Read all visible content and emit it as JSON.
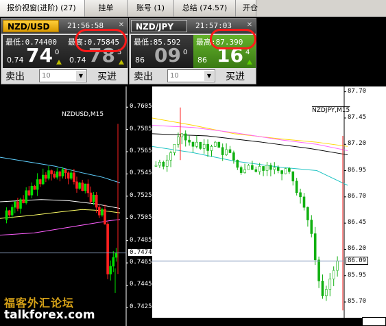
{
  "tabs": [
    {
      "label": "报价视窗(进阶) (27)",
      "active": true
    },
    {
      "label": "挂单",
      "active": false
    },
    {
      "label": "账号 (1)",
      "active": false
    },
    {
      "label": "总结 (74.57)",
      "active": false
    },
    {
      "label": "开仓",
      "active": false
    }
  ],
  "quotes": [
    {
      "symbol": "NZD/USD",
      "symbol_style": "gold",
      "time": "21:56:58",
      "sell": {
        "low_label": "最低:0.74400",
        "small": "0.74",
        "big": "74",
        "sup": "0",
        "label": "卖出"
      },
      "buy": {
        "high_label": "最高:0.75845",
        "small": "0.74",
        "big": "78",
        "sup": "5",
        "label": "买进"
      },
      "amount": "10"
    },
    {
      "symbol": "NZD/JPY",
      "symbol_style": "dark",
      "time": "21:57:03",
      "sell": {
        "low_label": "最低:85.592",
        "small": "86",
        "big": "09",
        "sup": "0",
        "label": "卖出"
      },
      "buy": {
        "high_label": "最高:87.390",
        "small": "86",
        "big": "16",
        "sup": "4",
        "label": "买进"
      },
      "amount": "10"
    }
  ],
  "chart_data": [
    {
      "type": "candlestick",
      "title": "NZDUSD,M15",
      "yticks": [
        "0.7605",
        "0.7585",
        "0.7565",
        "0.7545",
        "0.7525",
        "0.7505",
        "0.7485",
        "0.7465",
        "0.7445",
        "0.7425"
      ],
      "ylim": [
        0.742,
        0.7615
      ],
      "current_price": "0.7474",
      "ma_colors": [
        "#5fd0ff",
        "#ffff66",
        "#ff5fff",
        "#ffffff"
      ]
    },
    {
      "type": "candlestick",
      "title": "NZDJPY,M15",
      "yticks": [
        "87.70",
        "87.45",
        "87.20",
        "86.95",
        "86.70",
        "86.45",
        "86.20",
        "85.95",
        "85.70"
      ],
      "ylim": [
        85.55,
        87.75
      ],
      "current_price": "86.09",
      "ma_colors": [
        "#ffd700",
        "#ff66ff",
        "#22c4c4",
        "#000000"
      ]
    }
  ],
  "watermark": {
    "cn": "福客外汇论坛",
    "en": "talkforex.com"
  }
}
